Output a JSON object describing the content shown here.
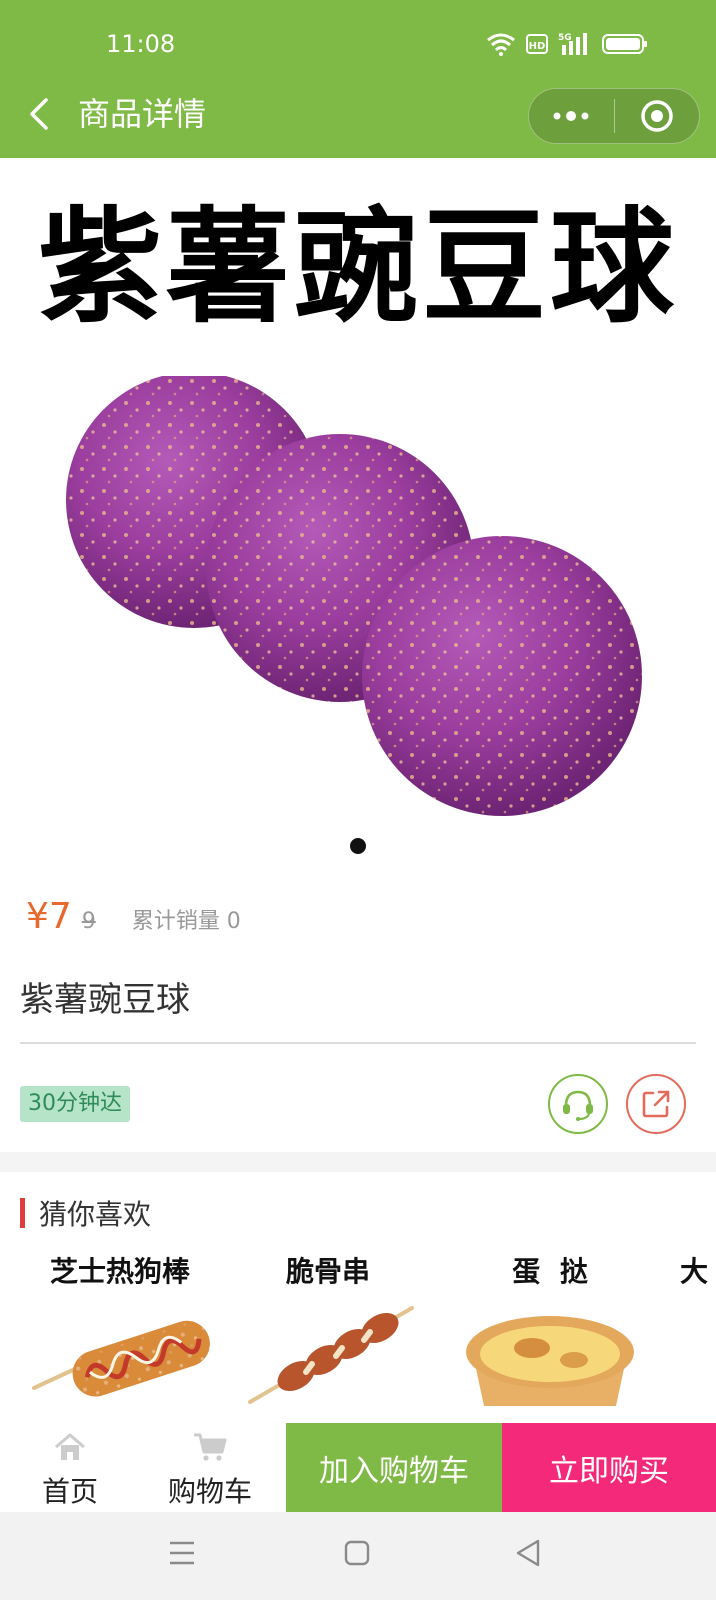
{
  "status_bar": {
    "time": "11:08",
    "network": "5G"
  },
  "nav": {
    "title": "商品详情"
  },
  "hero": {
    "title": "紫薯豌豆球"
  },
  "product": {
    "currency": "¥",
    "price": "7",
    "original_price": "9",
    "sales_label": "累计销量 0",
    "name": "紫薯豌豆球",
    "delivery_tag": "30分钟达"
  },
  "recommend": {
    "title": "猜你喜欢",
    "items": [
      {
        "name": "芝士热狗棒"
      },
      {
        "name": "脆骨串"
      },
      {
        "name": "蛋  挞"
      },
      {
        "name": "大"
      }
    ]
  },
  "bottom_bar": {
    "home_label": "首页",
    "cart_label": "购物车",
    "add_cart_label": "加入购物车",
    "buy_label": "立即购买"
  },
  "colors": {
    "brand_green": "#7fba46",
    "price_orange": "#e8692d",
    "buy_pink": "#f5297a",
    "accent_red": "#e03c3c"
  }
}
